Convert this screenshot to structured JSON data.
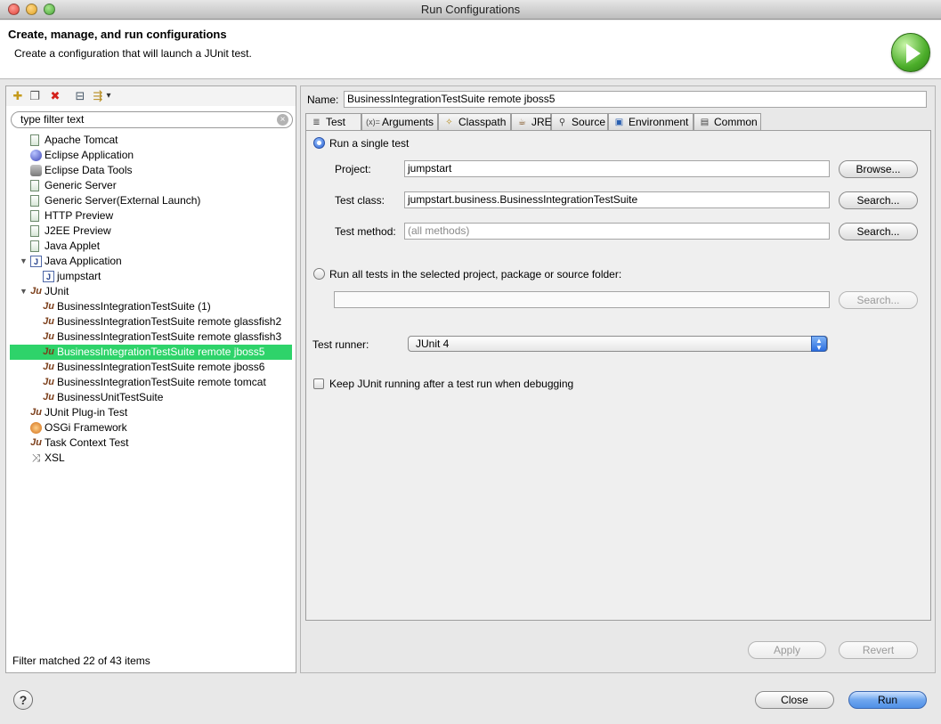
{
  "window": {
    "title": "Run Configurations"
  },
  "header": {
    "title": "Create, manage, and run configurations",
    "subtitle": "Create a configuration that will launch a JUnit test."
  },
  "left": {
    "toolbar": [
      {
        "name": "new-configuration-icon",
        "glyph": "✚"
      },
      {
        "name": "duplicate-icon",
        "glyph": "❐"
      },
      {
        "name": "delete-icon",
        "glyph": "✖"
      },
      {
        "name": "collapse-all-icon",
        "glyph": "⊟"
      },
      {
        "name": "filter-icon",
        "glyph": "⇶"
      },
      {
        "name": "view-menu-icon",
        "glyph": "▾"
      }
    ],
    "filter_placeholder": "type filter text",
    "tree": [
      {
        "label": "Apache Tomcat",
        "icon": "page",
        "level": 1
      },
      {
        "label": "Eclipse Application",
        "icon": "globe",
        "level": 1
      },
      {
        "label": "Eclipse Data Tools",
        "icon": "db",
        "level": 1
      },
      {
        "label": "Generic Server",
        "icon": "page",
        "level": 1
      },
      {
        "label": "Generic Server(External Launch)",
        "icon": "page",
        "level": 1
      },
      {
        "label": "HTTP Preview",
        "icon": "page",
        "level": 1
      },
      {
        "label": "J2EE Preview",
        "icon": "page",
        "level": 1
      },
      {
        "label": "Java Applet",
        "icon": "page",
        "level": 1
      },
      {
        "label": "Java Application",
        "icon": "j",
        "level": 1,
        "expanded": true
      },
      {
        "label": "jumpstart",
        "icon": "j",
        "level": 2
      },
      {
        "label": "JUnit",
        "icon": "ju",
        "level": 1,
        "expanded": true
      },
      {
        "label": "BusinessIntegrationTestSuite (1)",
        "icon": "ju",
        "level": 2
      },
      {
        "label": "BusinessIntegrationTestSuite remote glassfish2",
        "icon": "ju",
        "level": 2
      },
      {
        "label": "BusinessIntegrationTestSuite remote glassfish3",
        "icon": "ju",
        "level": 2
      },
      {
        "label": "BusinessIntegrationTestSuite remote jboss5",
        "icon": "ju",
        "level": 2,
        "selected": true
      },
      {
        "label": "BusinessIntegrationTestSuite remote jboss6",
        "icon": "ju",
        "level": 2
      },
      {
        "label": "BusinessIntegrationTestSuite remote tomcat",
        "icon": "ju",
        "level": 2
      },
      {
        "label": "BusinessUnitTestSuite",
        "icon": "ju",
        "level": 2
      },
      {
        "label": "JUnit Plug-in Test",
        "icon": "ju",
        "level": 1
      },
      {
        "label": "OSGi Framework",
        "icon": "osgi",
        "level": 1
      },
      {
        "label": "Task Context Test",
        "icon": "ju",
        "level": 1
      },
      {
        "label": "XSL",
        "icon": "xsl",
        "level": 1
      }
    ],
    "status": "Filter matched 22 of 43 items"
  },
  "right": {
    "name_label": "Name:",
    "name_value": "BusinessIntegrationTestSuite remote jboss5",
    "tabs": [
      {
        "label": "Test",
        "icon": "≣",
        "active": true
      },
      {
        "label": "Arguments",
        "icon": "(x)="
      },
      {
        "label": "Classpath",
        "icon": "✧"
      },
      {
        "label": "JRE",
        "icon": "☕"
      },
      {
        "label": "Source",
        "icon": "⚲"
      },
      {
        "label": "Environment",
        "icon": "▣"
      },
      {
        "label": "Common",
        "icon": "▤"
      }
    ],
    "test": {
      "single_label": "Run a single test",
      "project_label": "Project:",
      "project_value": "jumpstart",
      "browse_label": "Browse...",
      "class_label": "Test class:",
      "class_value": "jumpstart.business.BusinessIntegrationTestSuite",
      "search_label": "Search...",
      "method_label": "Test method:",
      "method_placeholder": "(all methods)",
      "all_label": "Run all tests in the selected project, package or source folder:",
      "runner_label": "Test runner:",
      "runner_value": "JUnit 4",
      "keep_label": "Keep JUnit running after a test run when debugging"
    },
    "apply_label": "Apply",
    "revert_label": "Revert"
  },
  "footer": {
    "help_label": "?",
    "close_label": "Close",
    "run_label": "Run"
  }
}
